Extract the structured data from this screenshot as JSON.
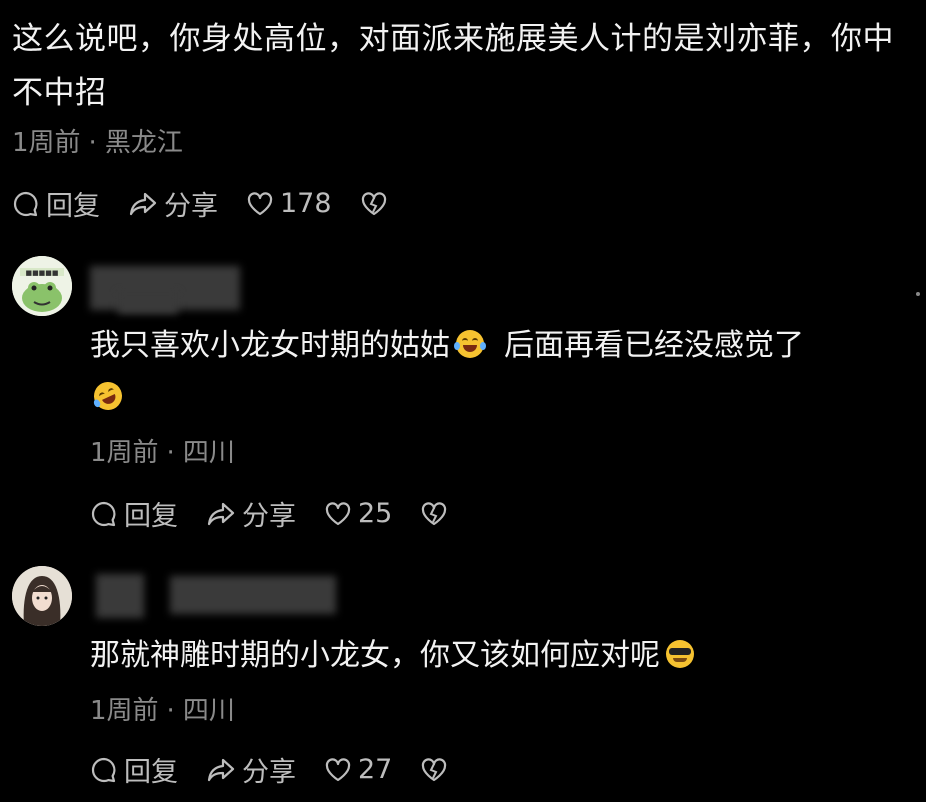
{
  "post": {
    "text": "这么说吧，你身处高位，对面派来施展美人计的是刘亦菲，你中不中招",
    "time": "1周前",
    "location": "黑龙江",
    "reply_label": "回复",
    "share_label": "分享",
    "likes": "178"
  },
  "replies": [
    {
      "text_a": "我只喜欢小龙女时期的姑姑",
      "text_b": "后面再看已经没感觉了",
      "time": "1周前",
      "location": "四川",
      "reply_label": "回复",
      "share_label": "分享",
      "likes": "25"
    },
    {
      "text_a": "那就神雕时期的小龙女，你又该如何应对呢",
      "time": "1周前",
      "location": "四川",
      "reply_label": "回复",
      "share_label": "分享",
      "likes": "27"
    }
  ],
  "colors": {
    "background": "#000000",
    "text": "#f2f2f2",
    "meta": "#8a8a8a",
    "action": "#bdbdbd"
  }
}
